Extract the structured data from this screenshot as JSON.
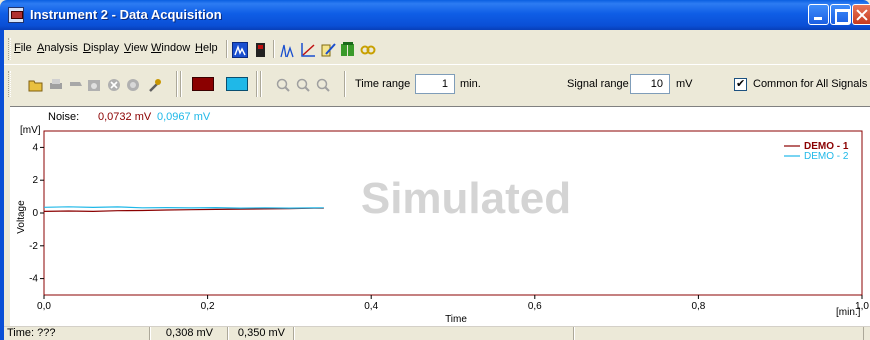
{
  "window": {
    "title": "Instrument 2 - Data Acquisition"
  },
  "menu": {
    "items": [
      "File",
      "Analysis",
      "Display",
      "View",
      "Window",
      "Help"
    ]
  },
  "toolbar": {
    "time_range_label": "Time range",
    "time_range_value": "1",
    "time_range_unit": "min.",
    "signal_range_label": "Signal range",
    "signal_range_value": "10",
    "signal_range_unit": "mV",
    "common_label": "Common for All Signals",
    "common_checked": true
  },
  "plot": {
    "noise_label": "Noise:",
    "noise_value_1": "0,0732 mV",
    "noise_value_2": "0,0967 mV",
    "watermark": "Simulated",
    "y_unit": "[mV]",
    "x_unit": "[min.]"
  },
  "chart_data": {
    "type": "line",
    "xlabel": "Time",
    "ylabel": "Voltage",
    "xlim": [
      0.0,
      1.0
    ],
    "ylim": [
      -5,
      5
    ],
    "x_ticks": [
      "0,0",
      "0,2",
      "0,4",
      "0,6",
      "0,8",
      "1,0"
    ],
    "y_ticks": [
      "4",
      "2",
      "0",
      "-2",
      "-4"
    ],
    "grid": false,
    "legend_position": "top-right",
    "series": [
      {
        "name": "DEMO - 1",
        "color": "#8b0000",
        "x": [
          0.0,
          0.03,
          0.06,
          0.09,
          0.12,
          0.15,
          0.18,
          0.21,
          0.24,
          0.27,
          0.3,
          0.33,
          0.342
        ],
        "y": [
          0.1,
          0.12,
          0.1,
          0.14,
          0.15,
          0.18,
          0.2,
          0.22,
          0.24,
          0.25,
          0.27,
          0.29,
          0.3
        ]
      },
      {
        "name": "DEMO - 2",
        "color": "#1fb8e8",
        "x": [
          0.0,
          0.03,
          0.06,
          0.09,
          0.12,
          0.15,
          0.18,
          0.21,
          0.24,
          0.27,
          0.3,
          0.33,
          0.342
        ],
        "y": [
          0.35,
          0.38,
          0.34,
          0.37,
          0.32,
          0.33,
          0.31,
          0.33,
          0.3,
          0.32,
          0.3,
          0.31,
          0.32
        ]
      }
    ]
  },
  "status": {
    "time": "Time: ???",
    "value_1": "0,308 mV",
    "value_2": "0,350 mV"
  },
  "colors": {
    "accent": "#0a4fd6",
    "plot_border": "#8b0000",
    "series_1": "#8b0000",
    "series_2": "#1fb8e8"
  }
}
